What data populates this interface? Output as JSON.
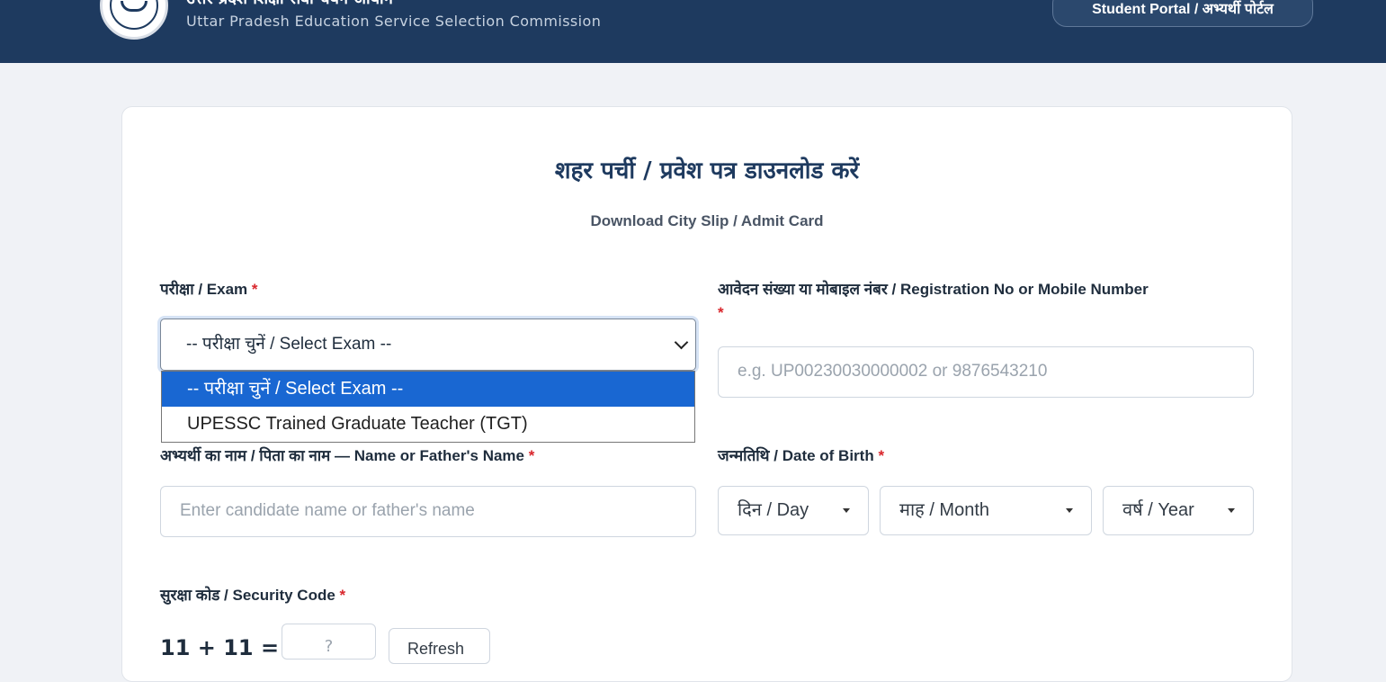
{
  "header": {
    "org_title_hi": "उत्तर प्रदेश शिक्षा सेवा चयन आयोग",
    "org_title_en": "Uttar Pradesh Education Service Selection Commission",
    "portal_button": "Student Portal / अभ्यर्थी पोर्टल"
  },
  "form": {
    "title_hi": "शहर पर्ची / प्रवेश पत्र डाउनलोड करें",
    "title_en": "Download City Slip / Admit Card",
    "required_mark": "*",
    "exam": {
      "label": "परीक्षा / Exam",
      "selected": "-- परीक्षा चुनें / Select Exam --",
      "options": [
        "-- परीक्षा चुनें / Select Exam --",
        "UPESSC Trained Graduate Teacher (TGT)"
      ]
    },
    "registration": {
      "label": "आवेदन संख्या या मोबाइल नंबर / Registration No or Mobile Number",
      "placeholder": "e.g. UP00230030000002 or 9876543210"
    },
    "name": {
      "label": "अभ्यर्थी का नाम / पिता का नाम — Name or Father's Name",
      "placeholder": "Enter candidate name or father's name"
    },
    "dob": {
      "label": "जन्मतिथि / Date of Birth",
      "day": "दिन / Day",
      "month": "माह / Month",
      "year": "वर्ष / Year"
    },
    "security": {
      "label": "सुरक्षा कोड / Security Code",
      "captcha": "11 + 11 =",
      "placeholder": "?",
      "refresh": "Refresh"
    }
  }
}
